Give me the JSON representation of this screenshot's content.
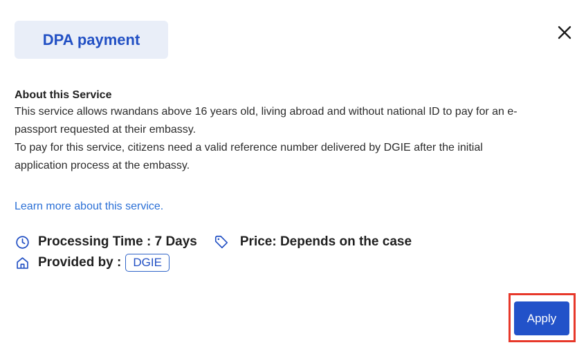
{
  "modal": {
    "title": "DPA payment",
    "close_icon": "close-icon"
  },
  "about": {
    "heading": "About this Service",
    "line1": "This service allows rwandans above 16 years old, living abroad and without national ID to pay for an e-",
    "line2": "passport requested at their embassy.",
    "line3": "To pay for this service, citizens need a valid reference number delivered by DGIE after the initial",
    "line4": "application process at the embassy."
  },
  "learn_more": {
    "label": "Learn more about this service."
  },
  "meta": {
    "processing_icon": "clock-icon",
    "processing_label": "Processing Time : 7 Days",
    "price_icon": "tag-icon",
    "price_label": "Price: Depends on the case",
    "provider_icon": "home-icon",
    "provider_label": "Provided by :",
    "provider_value": "DGIE"
  },
  "actions": {
    "apply_label": "Apply",
    "highlight_color": "#e7382a",
    "button_color": "#2252c9"
  },
  "colors": {
    "accent": "#2250c4",
    "title_bg": "#e9eef8",
    "link": "#2a6fd6"
  }
}
